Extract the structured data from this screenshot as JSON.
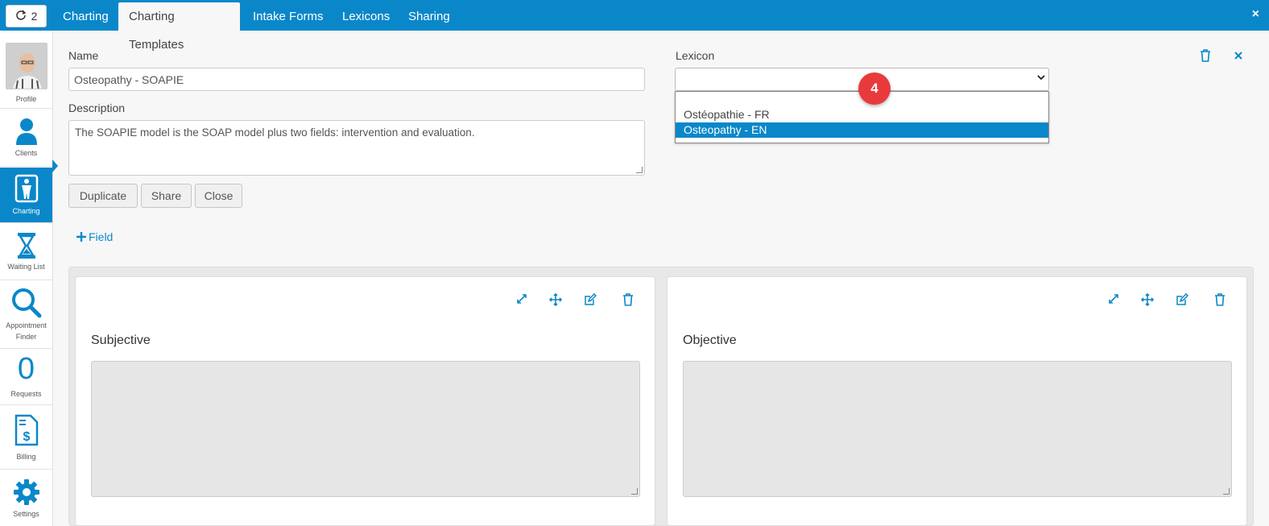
{
  "topbar": {
    "refresh_count": "2",
    "tabs": [
      {
        "label": "Charting"
      },
      {
        "label": "Charting Templates",
        "active": true
      },
      {
        "label": "Intake Forms"
      },
      {
        "label": "Lexicons"
      },
      {
        "label": "Sharing"
      }
    ],
    "close_label": "×"
  },
  "sidebar": {
    "items": [
      {
        "label": "Profile"
      },
      {
        "label": "Clients"
      },
      {
        "label": "Charting",
        "active": true
      },
      {
        "label": "Waiting List"
      },
      {
        "label": "Appointment Finder"
      },
      {
        "label": "Requests",
        "count": "0"
      },
      {
        "label": "Billing"
      },
      {
        "label": "Settings"
      }
    ]
  },
  "form": {
    "name_label": "Name",
    "name_value": "Osteopathy - SOAPIE",
    "description_label": "Description",
    "description_value": "The SOAPIE model is the SOAP model plus two fields: intervention and evaluation.",
    "lexicon_label": "Lexicon",
    "lexicon_value": "",
    "lexicon_options": [
      "Ostéopathie - FR",
      "Osteopathy - EN"
    ],
    "lexicon_highlighted": "Osteopathy - EN",
    "buttons": {
      "duplicate": "Duplicate",
      "share": "Share",
      "close": "Close"
    },
    "annotation_badge": "4"
  },
  "add_field_label": "Field",
  "panels": [
    {
      "title": "Subjective"
    },
    {
      "title": "Objective"
    }
  ],
  "colors": {
    "accent": "#0a87c9",
    "badge": "#e83a3a",
    "background": "#f7f7f7"
  }
}
